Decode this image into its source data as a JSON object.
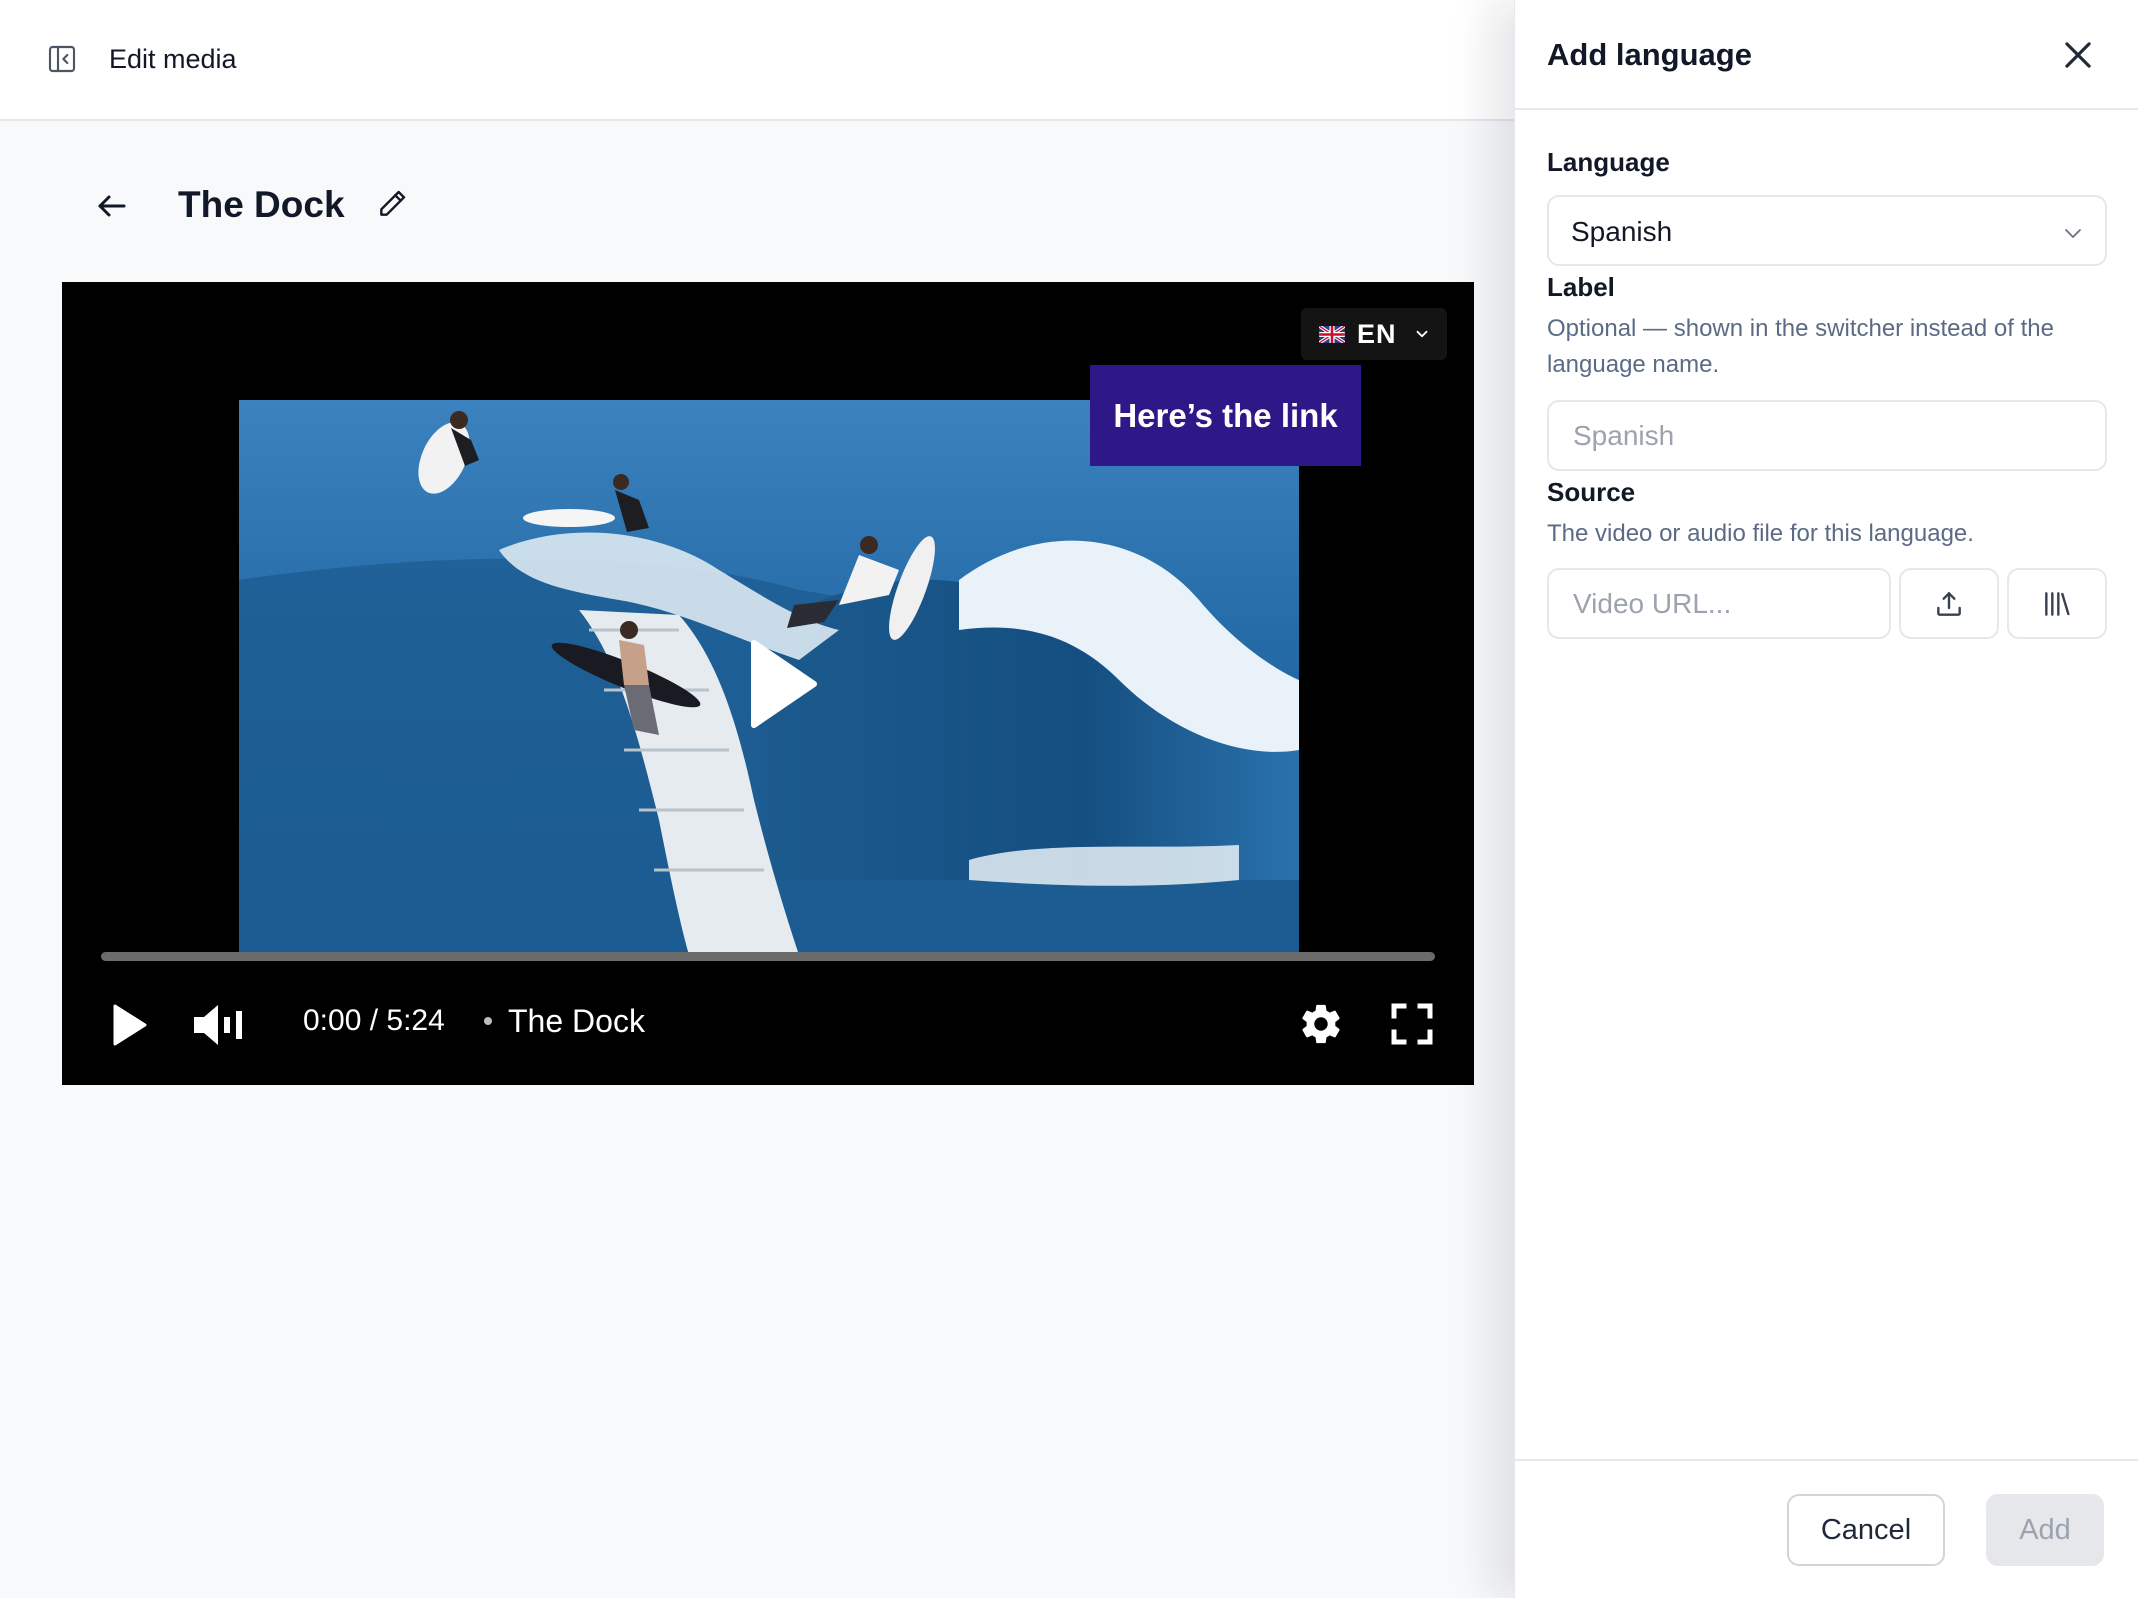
{
  "topbar": {
    "sidebar_toggle_icon": "panel-left-collapse-icon",
    "title": "Edit media"
  },
  "media": {
    "back_icon": "arrow-left-icon",
    "title": "The Dock",
    "edit_icon": "pencil-icon"
  },
  "player": {
    "language_switcher": {
      "flag_icon": "uk-flag-icon",
      "code": "EN",
      "chevron_icon": "chevron-down-icon"
    },
    "callout_text": "Here’s the link",
    "big_play_icon": "play-icon",
    "progress": 0,
    "controls": {
      "play_icon": "play-icon",
      "volume_icon": "volume-icon",
      "time": "0:00 / 5:24",
      "title": "The Dock",
      "settings_icon": "gear-icon",
      "fullscreen_icon": "fullscreen-icon"
    }
  },
  "drawer": {
    "title": "Add language",
    "close_icon": "close-icon",
    "language": {
      "label": "Language",
      "selected": "Spanish",
      "chevron_icon": "chevron-down-icon"
    },
    "label_field": {
      "label": "Label",
      "help": "Optional — shown in the switcher instead of the language name.",
      "placeholder": "Spanish"
    },
    "source": {
      "label": "Source",
      "help": "The video or audio file for this language.",
      "placeholder": "Video URL...",
      "upload_icon": "upload-icon",
      "library_icon": "library-icon"
    },
    "footer": {
      "cancel_label": "Cancel",
      "add_label": "Add"
    }
  },
  "colors": {
    "callout_bg": "#2e1787",
    "player_bg": "#000000",
    "help_text": "#5b6b86",
    "disabled_button": "#e5e7eb"
  }
}
